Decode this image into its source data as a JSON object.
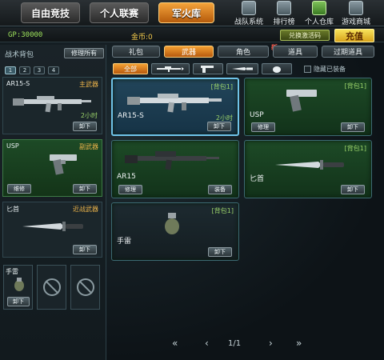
{
  "topbar": {
    "tabs": [
      {
        "label": "自由竞技",
        "active": false
      },
      {
        "label": "个人联赛",
        "active": false
      },
      {
        "label": "军火库",
        "active": true
      }
    ],
    "icons": [
      {
        "label": "战队系统",
        "icon": "team-icon"
      },
      {
        "label": "排行榜",
        "icon": "ranking-icon"
      },
      {
        "label": "个人仓库",
        "icon": "warehouse-icon",
        "highlight": true
      },
      {
        "label": "游戏商城",
        "icon": "shop-icon"
      }
    ]
  },
  "status": {
    "gp": "GP:30000",
    "coin": "金币:0",
    "redeem_label": "兑换激活码",
    "charge_label": "充值"
  },
  "left": {
    "title": "战术背包",
    "repair_all": "修理所有",
    "pages": [
      "1",
      "2",
      "3",
      "4"
    ],
    "slots": [
      {
        "name": "AR15-S",
        "category": "主武器",
        "time": "2小时",
        "buttons": [
          "卸下"
        ]
      },
      {
        "name": "USP",
        "category": "副武器",
        "buttons": [
          "维修",
          "卸下"
        ]
      },
      {
        "name": "匕首",
        "category": "近战武器",
        "buttons": [
          "卸下"
        ]
      }
    ],
    "mini_slot": {
      "name": "手雷",
      "button": "卸下"
    }
  },
  "filters": {
    "tabs": [
      {
        "label": "礼包",
        "active": false
      },
      {
        "label": "武器",
        "active": true
      },
      {
        "label": "角色",
        "active": false
      },
      {
        "label": "道具",
        "active": false
      },
      {
        "label": "过期道具",
        "active": false
      }
    ],
    "new_mark": "新",
    "subtabs": [
      {
        "label": "全部",
        "active": true
      }
    ],
    "hide_equipped": "隐藏已装备"
  },
  "items": [
    {
      "name": "AR15-S",
      "tag": "[背包1]",
      "time": "2小时",
      "buttons": [
        "卸下"
      ]
    },
    {
      "name": "USP",
      "tag": "[背包1]",
      "buttons": [
        "修理",
        "卸下"
      ]
    },
    {
      "name": "AR15",
      "tag": "",
      "buttons": [
        "修理",
        "装备"
      ]
    },
    {
      "name": "匕首",
      "tag": "[背包1]",
      "buttons": [
        "卸下"
      ]
    },
    {
      "name": "手雷",
      "tag": "[背包1]",
      "buttons": [
        "卸下"
      ]
    }
  ],
  "pager": {
    "first": "«",
    "prev": "‹",
    "text": "1/1",
    "next": "›",
    "last": "»"
  }
}
